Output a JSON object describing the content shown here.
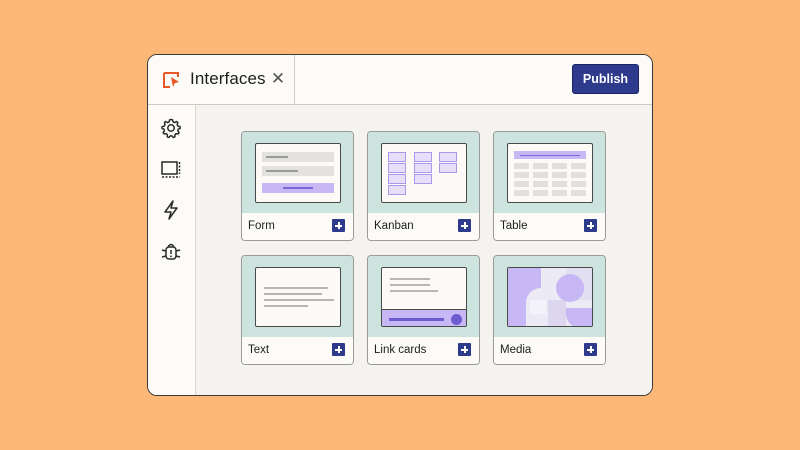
{
  "tab": {
    "title": "Interfaces",
    "app_icon": "interface-cursor-icon",
    "close_icon": "close-icon"
  },
  "header": {
    "publish_label": "Publish"
  },
  "sidebar": {
    "items": [
      {
        "icon": "gear-icon"
      },
      {
        "icon": "layout-icon"
      },
      {
        "icon": "lightning-icon"
      },
      {
        "icon": "bug-icon"
      }
    ]
  },
  "cards": [
    {
      "label": "Form"
    },
    {
      "label": "Kanban"
    },
    {
      "label": "Table"
    },
    {
      "label": "Text"
    },
    {
      "label": "Link cards"
    },
    {
      "label": "Media"
    }
  ],
  "colors": {
    "background": "#FDB877",
    "accent": "#2E3A8C",
    "preview": "#CDE3DE",
    "purple": "#C7B8F5",
    "brand_orange": "#E8572A"
  }
}
